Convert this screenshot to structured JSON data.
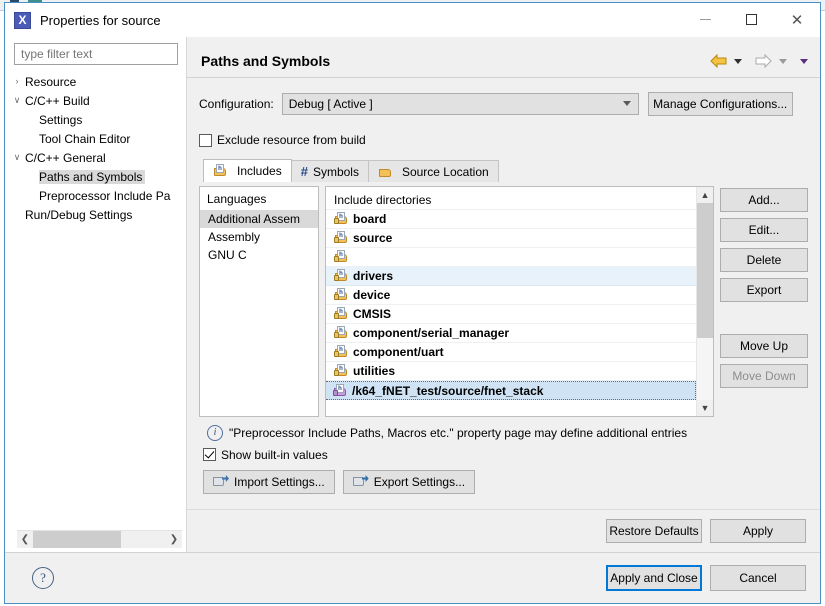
{
  "window": {
    "title": "Properties for source",
    "icon": "X",
    "controls": {
      "minimize": "minimize-icon",
      "maximize": "maximize-icon",
      "close": "✕"
    }
  },
  "sidebar": {
    "filter_placeholder": "type filter text",
    "filter_value": "",
    "items": [
      {
        "label": "Resource",
        "twisty": "›",
        "indent": 0,
        "selected": false
      },
      {
        "label": "C/C++ Build",
        "twisty": "∨",
        "indent": 0,
        "selected": false
      },
      {
        "label": "Settings",
        "twisty": "",
        "indent": 1,
        "selected": false
      },
      {
        "label": "Tool Chain Editor",
        "twisty": "",
        "indent": 1,
        "selected": false
      },
      {
        "label": "C/C++ General",
        "twisty": "∨",
        "indent": 0,
        "selected": false
      },
      {
        "label": "Paths and Symbols",
        "twisty": "",
        "indent": 1,
        "selected": true
      },
      {
        "label": "Preprocessor Include Pa",
        "twisty": "",
        "indent": 1,
        "selected": false
      },
      {
        "label": "Run/Debug Settings",
        "twisty": "",
        "indent": 0,
        "selected": false
      }
    ]
  },
  "page": {
    "title": "Paths and Symbols",
    "nav": {
      "back": "back-arrow",
      "forward": "forward-arrow",
      "menu": "dropdown-menu"
    }
  },
  "configuration": {
    "label": "Configuration:",
    "value": "Debug  [ Active ]",
    "manage_button": "Manage Configurations..."
  },
  "exclude": {
    "label": "Exclude resource from build",
    "checked": false
  },
  "tabs": [
    {
      "label": "Includes",
      "icon": "includes-icon",
      "active": true
    },
    {
      "label": "Symbols",
      "icon": "hash-icon",
      "active": false
    },
    {
      "label": "Source Location",
      "icon": "folder-icon",
      "active": false
    }
  ],
  "languages": {
    "header": "Languages",
    "items": [
      {
        "label": "Additional Assem",
        "selected": true
      },
      {
        "label": "Assembly",
        "selected": false
      },
      {
        "label": "GNU C",
        "selected": false
      }
    ]
  },
  "includes": {
    "header": "Include directories",
    "rows": [
      {
        "label": "board",
        "state": "normal",
        "icon": "include-folder-icon"
      },
      {
        "label": "source",
        "state": "normal",
        "icon": "include-folder-icon"
      },
      {
        "label": "",
        "state": "normal",
        "icon": "include-folder-icon"
      },
      {
        "label": "drivers",
        "state": "hover",
        "icon": "include-folder-icon"
      },
      {
        "label": "device",
        "state": "normal",
        "icon": "include-folder-icon"
      },
      {
        "label": "CMSIS",
        "state": "normal",
        "icon": "include-folder-icon"
      },
      {
        "label": "component/serial_manager",
        "state": "normal",
        "icon": "include-folder-icon"
      },
      {
        "label": "component/uart",
        "state": "normal",
        "icon": "include-folder-icon"
      },
      {
        "label": "utilities",
        "state": "normal",
        "icon": "include-folder-icon"
      },
      {
        "label": "/k64_fNET_test/source/fnet_stack",
        "state": "selected",
        "icon": "workspace-folder-icon"
      }
    ]
  },
  "side_buttons": [
    {
      "label": "Add...",
      "enabled": true
    },
    {
      "label": "Edit...",
      "enabled": true
    },
    {
      "label": "Delete",
      "enabled": true
    },
    {
      "label": "Export",
      "enabled": true
    },
    {
      "label": "Move Up",
      "enabled": true
    },
    {
      "label": "Move Down",
      "enabled": false
    }
  ],
  "info": {
    "text": "\"Preprocessor Include Paths, Macros etc.\" property page may define additional entries",
    "icon": "info-icon"
  },
  "builtin": {
    "label": "Show built-in values",
    "checked": true
  },
  "settings_buttons": [
    {
      "label": "Import Settings...",
      "icon": "import-icon"
    },
    {
      "label": "Export Settings...",
      "icon": "export-icon"
    }
  ],
  "bottom_buttons": [
    {
      "label": "Restore Defaults"
    },
    {
      "label": "Apply"
    }
  ],
  "footer": {
    "help_icon": "?",
    "buttons": [
      {
        "label": "Apply and Close",
        "primary": true
      },
      {
        "label": "Cancel",
        "primary": false
      }
    ]
  },
  "colors": {
    "accent": "#0078d7",
    "selection": "#cfe3f5",
    "hover": "#e8f2fb",
    "window_border": "#4a90c4"
  }
}
